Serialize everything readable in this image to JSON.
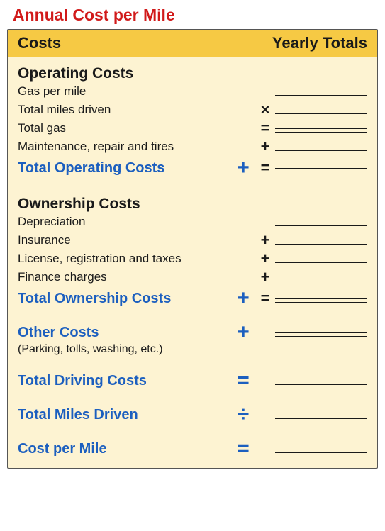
{
  "title": "Annual Cost per Mile",
  "header": {
    "left": "Costs",
    "right": "Yearly Totals"
  },
  "operating": {
    "section": "Operating Costs",
    "gas_per_mile": "Gas per mile",
    "total_miles": "Total miles driven",
    "total_gas": "Total gas",
    "maintenance": "Maintenance, repair and tires",
    "total": "Total Operating Costs"
  },
  "ownership": {
    "section": "Ownership Costs",
    "depreciation": "Depreciation",
    "insurance": "Insurance",
    "license": "License, registration and taxes",
    "finance": "Finance charges",
    "total": "Total Ownership Costs"
  },
  "other": {
    "label": "Other Costs",
    "note": "(Parking, tolls, washing, etc.)"
  },
  "driving_total": "Total Driving Costs",
  "miles_driven": "Total Miles Driven",
  "cost_per_mile": "Cost per Mile",
  "sym": {
    "plus": "+",
    "times": "×",
    "eq": "=",
    "div": "÷"
  }
}
